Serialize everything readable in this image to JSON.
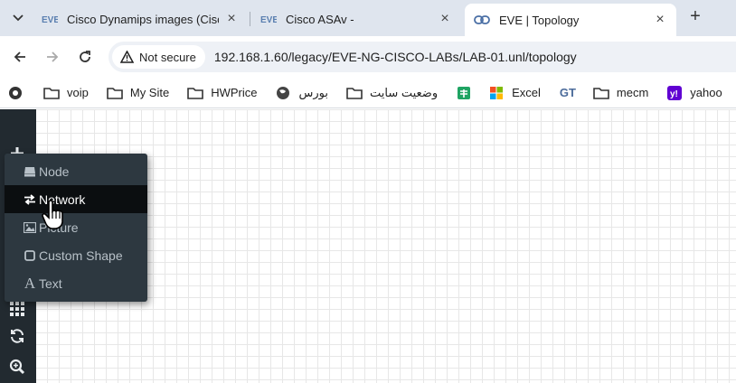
{
  "tabs": [
    {
      "title": "Cisco Dynamips images (Cisco",
      "icon": "eve-logo-icon",
      "active": false
    },
    {
      "title": "Cisco ASAv -",
      "icon": "eve-logo-icon",
      "active": false
    },
    {
      "title": "EVE | Topology",
      "icon": "eve-link-icon",
      "active": true
    }
  ],
  "toolbar": {
    "security_label": "Not secure",
    "url": "192.168.1.60/legacy/EVE-NG-CISCO-LABs/LAB-01.unl/topology"
  },
  "bookmarks": [
    {
      "label": "voip",
      "icon": "folder-icon"
    },
    {
      "label": "My Site",
      "icon": "folder-icon"
    },
    {
      "label": "HWPrice",
      "icon": "folder-icon"
    },
    {
      "label": "بورس",
      "icon": "globe-icon"
    },
    {
      "label": "وضعیت سایت",
      "icon": "folder-icon"
    },
    {
      "label": "",
      "icon": "sheets-icon"
    },
    {
      "label": "Excel",
      "icon": "microsoft-icon"
    },
    {
      "label": "",
      "icon": "gt-icon"
    },
    {
      "label": "mecm",
      "icon": "folder-icon"
    },
    {
      "label": "yahoo",
      "icon": "yahoo-icon"
    }
  ],
  "bookmark_gt_text": "GT",
  "menu": {
    "items": [
      {
        "label": "Node",
        "icon": "node-icon"
      },
      {
        "label": "Network",
        "icon": "network-exchange-icon"
      },
      {
        "label": "Picture",
        "icon": "picture-icon"
      },
      {
        "label": "Custom Shape",
        "icon": "shape-icon"
      },
      {
        "label": "Text",
        "icon": "text-icon"
      }
    ],
    "text_glyph": "A"
  },
  "colors": {
    "sidebar": "#222a30",
    "menu_bg": "#2d3840",
    "menu_hover": "#0b0e10",
    "tabstrip": "#dfe5ee"
  }
}
